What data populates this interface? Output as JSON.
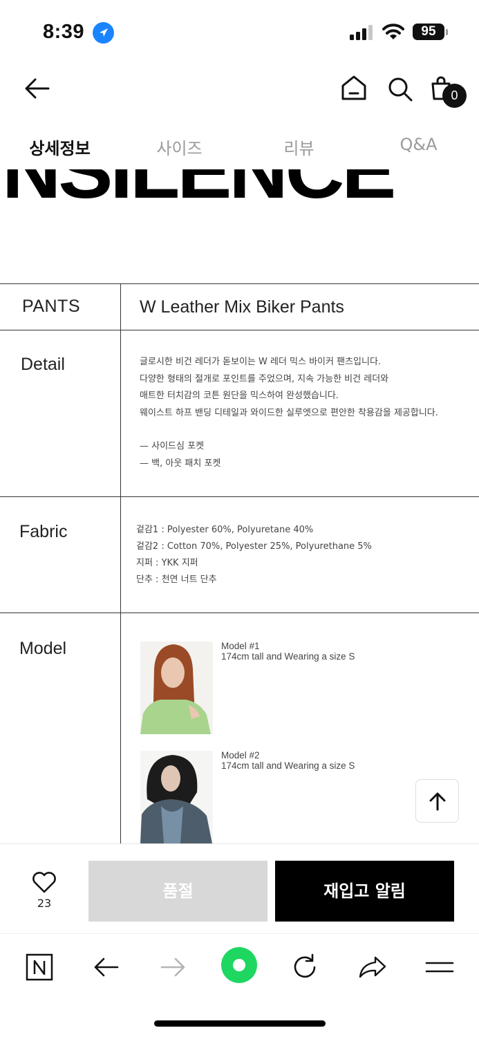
{
  "status_bar": {
    "time": "8:39",
    "battery": "95"
  },
  "header": {
    "cart_count": "0"
  },
  "tabs": [
    {
      "label": "상세정보",
      "active": true
    },
    {
      "label": "사이즈",
      "active": false
    },
    {
      "label": "리뷰",
      "active": false
    },
    {
      "label": "Q&A",
      "active": false
    }
  ],
  "banner": {
    "text": "INSILENCE"
  },
  "product": {
    "category": "PANTS",
    "name": "W Leather Mix Biker Pants"
  },
  "detail": {
    "label": "Detail",
    "lines": [
      "글로시한 비건 레더가 돋보이는 W 레더 믹스 바이커 팬츠입니다.",
      "다양한 형태의 절개로 포인트를 주었으며, 지속 가능한 비건 레더와",
      "매트한 터치감의 코튼 원단을 믹스하여 완성했습니다.",
      "웨이스트 하프 밴딩 디테일과 와이드한 실루엣으로 편안한 착용감을 제공합니다."
    ],
    "bullets": [
      "— 사이드심 포켓",
      "— 백, 아웃 패치 포켓"
    ]
  },
  "fabric": {
    "label": "Fabric",
    "lines": [
      "겉감1 : Polyester 60%, Polyuretane 40%",
      "겉감2 : Cotton 70%, Polyester 25%, Polyurethane 5%",
      "지퍼 : YKK 지퍼",
      "단추 : 천연 너트 단추"
    ]
  },
  "model": {
    "label": "Model",
    "items": [
      {
        "title": "Model #1",
        "info": "174cm tall and Wearing a size S"
      },
      {
        "title": "Model #2",
        "info": "174cm tall and Wearing a size S"
      }
    ]
  },
  "buy_bar": {
    "like_count": "23",
    "soldout_label": "품절",
    "restock_label": "재입고 알림"
  },
  "browser_nav": {
    "icons": [
      "n-logo-icon",
      "back-arrow-icon",
      "forward-arrow-icon",
      "green-dot-icon",
      "reload-icon",
      "share-icon",
      "menu-icon"
    ]
  },
  "colors": {
    "accent_green": "#1ed760",
    "location_blue": "#1a84ff",
    "soldout_gray": "#d8d8d8"
  }
}
